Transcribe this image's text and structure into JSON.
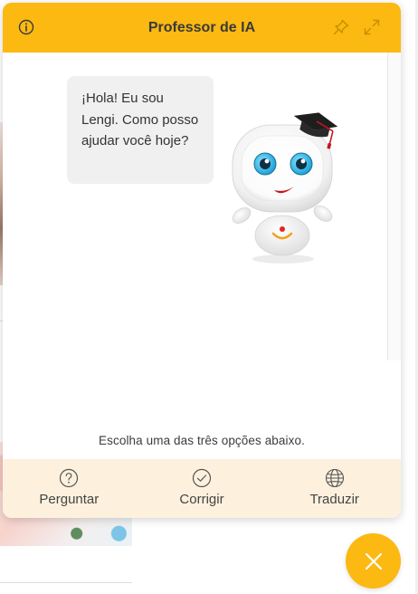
{
  "widget": {
    "title": "Professor de IA",
    "accent_color": "#fbb911",
    "options_background": "#fdf1de",
    "header_icons": [
      "info-icon",
      "pin-icon",
      "expand-icon"
    ]
  },
  "chat": {
    "bot_message": "¡Hola! Eu sou Lengi. Como posso ajudar você hoje?",
    "avatar": "robot-graduation-cap-mascot"
  },
  "prompt": "Escolha uma das três opções abaixo.",
  "options": [
    {
      "label": "Perguntar",
      "icon": "question-circle-icon"
    },
    {
      "label": "Corrigir",
      "icon": "check-circle-icon"
    },
    {
      "label": "Traduzir",
      "icon": "globe-icon"
    }
  ],
  "fab": {
    "icon": "close-icon"
  }
}
